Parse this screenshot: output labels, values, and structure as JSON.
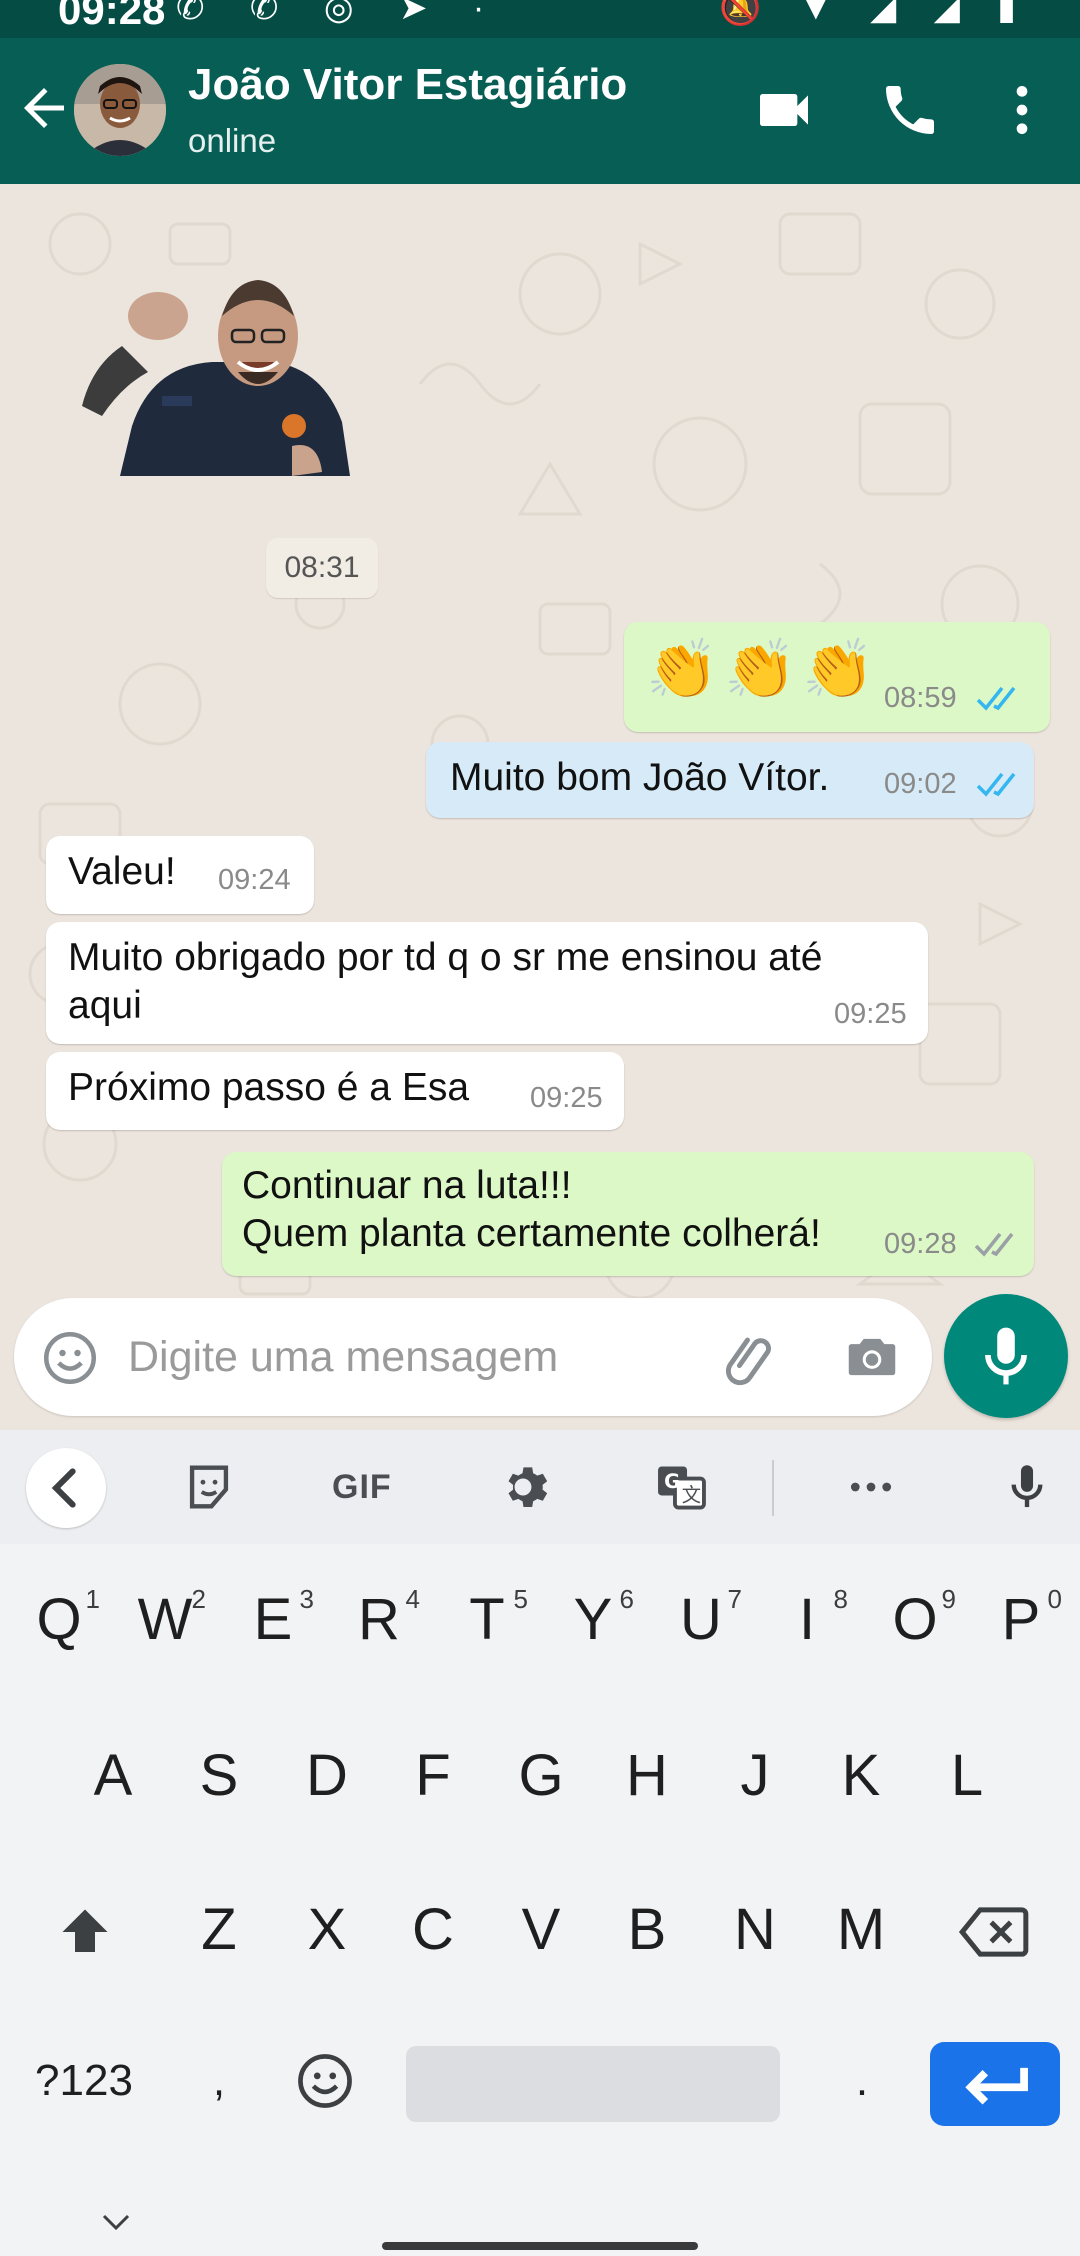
{
  "status_bar": {
    "time": "09:28",
    "left_icons": "✆ ✆ ◎ ➤ ·",
    "right_icons": "🔕 ▼ ◢ ◢ ▮"
  },
  "header": {
    "contact_name": "João Vitor Estagiário",
    "status": "online"
  },
  "chat": {
    "date_chip": "08:31",
    "messages": [
      {
        "side": "out",
        "kind": "emoji",
        "text": "👏👏👏",
        "time": "08:59",
        "ticks": "read"
      },
      {
        "side": "out",
        "kind": "text",
        "text": "Muito bom João Vítor.",
        "time": "09:02",
        "ticks": "read"
      },
      {
        "side": "in",
        "kind": "text",
        "text": "Valeu!",
        "time": "09:24"
      },
      {
        "side": "in",
        "kind": "text",
        "line1": "Muito obrigado por td q o sr me ensinou até",
        "line2": "aqui",
        "time": "09:25"
      },
      {
        "side": "in",
        "kind": "text",
        "text": "Próximo passo é a Esa",
        "time": "09:25"
      },
      {
        "side": "out",
        "kind": "text",
        "line1": "Continuar na luta!!!",
        "line2": "Quem planta certamente colherá!",
        "time": "09:28",
        "ticks": "delivered"
      }
    ]
  },
  "composer": {
    "placeholder": "Digite uma mensagem"
  },
  "keyboard": {
    "toolbar": {
      "gif": "GIF"
    },
    "row1": [
      {
        "k": "Q",
        "h": "1"
      },
      {
        "k": "W",
        "h": "2"
      },
      {
        "k": "E",
        "h": "3"
      },
      {
        "k": "R",
        "h": "4"
      },
      {
        "k": "T",
        "h": "5"
      },
      {
        "k": "Y",
        "h": "6"
      },
      {
        "k": "U",
        "h": "7"
      },
      {
        "k": "I",
        "h": "8"
      },
      {
        "k": "O",
        "h": "9"
      },
      {
        "k": "P",
        "h": "0"
      }
    ],
    "row2": [
      "A",
      "S",
      "D",
      "F",
      "G",
      "H",
      "J",
      "K",
      "L"
    ],
    "row3": [
      "Z",
      "X",
      "C",
      "V",
      "B",
      "N",
      "M"
    ],
    "numbers_key": "?123",
    "comma_key": ",",
    "period_key": "."
  },
  "colors": {
    "header": "#075e54",
    "status_bar": "#054d44",
    "out_bubble": "#dcf8c6",
    "in_bubble": "#ffffff",
    "read_ticks": "#34b7f1",
    "mic_button": "#00897b",
    "enter_key": "#1a73e8"
  },
  "icons": [
    "back-arrow-icon",
    "video-call-icon",
    "phone-icon",
    "more-vert-icon",
    "emoji-icon",
    "paperclip-icon",
    "camera-icon",
    "mic-icon",
    "sticker-icon",
    "gear-icon",
    "translate-icon",
    "ellipsis-icon",
    "shift-icon",
    "backspace-icon",
    "enter-icon",
    "chevron-down-icon"
  ]
}
